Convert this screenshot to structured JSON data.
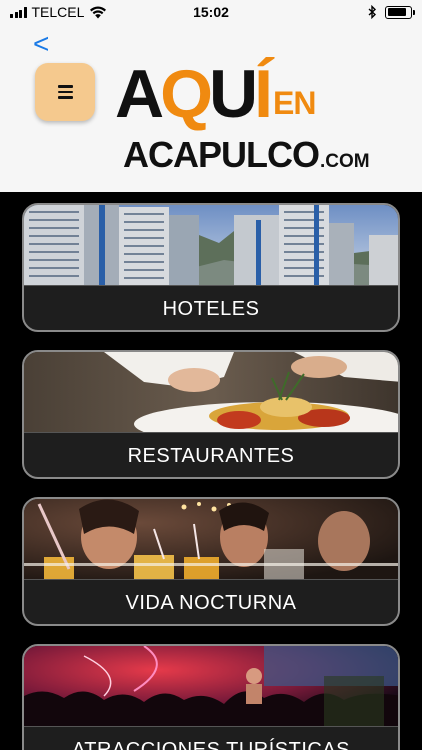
{
  "status_bar": {
    "carrier": "TELCEL",
    "time": "15:02",
    "battery_level": 0.85
  },
  "header": {
    "back_icon": "back-chevron-icon",
    "back_glyph": "<",
    "menu_icon": "hamburger-menu-icon",
    "logo": {
      "aqui": "AQUÍ",
      "en": "EN",
      "acapulco": "ACAPULCO",
      "com": ".COM",
      "accent_color": "#f08a10"
    }
  },
  "categories": [
    {
      "label": "HOTELES",
      "image": "hotel-towers-photo"
    },
    {
      "label": "RESTAURANTES",
      "image": "plated-food-photo"
    },
    {
      "label": "VIDA NOCTURNA",
      "image": "nightlife-drinks-photo"
    },
    {
      "label": "ATRACCIONES TURÍSTICAS",
      "image": "concert-crowd-photo"
    }
  ],
  "colors": {
    "header_bg": "#f6f6f6",
    "menu_button_bg": "#f5c98e",
    "back_link": "#1a7ae6",
    "card_label_bg": "#1e1e1e"
  }
}
